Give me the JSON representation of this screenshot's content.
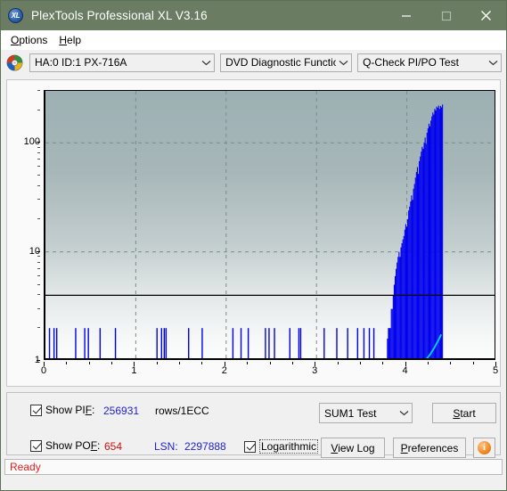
{
  "window": {
    "title": "PlexTools Professional XL V3.16",
    "app_icon": "xl-disc-icon",
    "minimize_label": "–",
    "maximize_label": "□",
    "close_label": "✕",
    "titlebar_color": "#6a7d63"
  },
  "menubar": {
    "items": [
      {
        "label": "Options",
        "accel": "O"
      },
      {
        "label": "Help",
        "accel": "H"
      }
    ]
  },
  "toolbar": {
    "drive_icon": "cd-disc-icon",
    "drive": {
      "value": "HA:0 ID:1  PX-716A"
    },
    "function": {
      "value": "DVD Diagnostic Functions"
    },
    "test": {
      "value": "Q-Check PI/PO Test"
    }
  },
  "chart_data": {
    "type": "bar",
    "title": "",
    "xlabel": "",
    "ylabel": "",
    "logarithmic": true,
    "grid": true,
    "xlim": [
      0,
      5
    ],
    "ylim": [
      1,
      300
    ],
    "xticks": [
      "0",
      "1",
      "2",
      "3",
      "4",
      "5"
    ],
    "yticks": [
      "1",
      "10",
      "100"
    ],
    "threshold_line": 4,
    "legend": [
      "PIF",
      "POF"
    ],
    "series": [
      {
        "name": "PIF",
        "color": "#0000ee",
        "comment": "sparse isolated spikes of height ~2-3 across 0-3.8, then a solid dense block rising from ~3.78 to ~4.40 peaking near 200",
        "spikes_x": [
          0.04,
          0.09,
          0.12,
          0.33,
          0.43,
          0.47,
          0.6,
          0.77,
          1.23,
          1.28,
          1.31,
          1.33,
          1.58,
          1.73,
          2.07,
          2.16,
          2.24,
          2.43,
          2.47,
          2.53,
          2.7,
          2.8,
          2.82,
          3.08,
          3.22,
          3.34,
          3.45,
          3.52,
          3.58,
          3.63
        ],
        "spikes_value": 2,
        "block_start": 3.78,
        "block_end": 4.4,
        "block_profile": [
          1.6,
          2,
          2,
          2,
          3,
          3,
          4,
          5,
          6,
          7,
          8,
          9,
          10,
          9,
          11,
          12,
          13,
          14,
          16,
          18,
          17,
          20,
          24,
          26,
          29,
          33,
          30,
          38,
          42,
          48,
          54,
          60,
          52,
          68,
          75,
          83,
          92,
          88,
          100,
          112,
          98,
          124,
          136,
          150,
          142,
          160,
          175,
          190,
          182,
          205,
          198,
          215,
          210,
          220,
          205,
          218,
          212,
          225
        ]
      },
      {
        "name": "POF",
        "color": "#00ccee",
        "comment": "low cyan trace rising near the end of the block",
        "x": [
          4.18,
          4.22,
          4.26,
          4.3,
          4.34,
          4.38
        ],
        "values": [
          1.0,
          1.05,
          1.15,
          1.3,
          1.5,
          1.75
        ]
      }
    ]
  },
  "controls": {
    "show_pif": {
      "label_pre": "Show PI",
      "label_accel": "F",
      "label_post": ":",
      "checked": true,
      "value": "256931",
      "unit": "rows/1ECC"
    },
    "show_pof": {
      "label_pre": "Show PO",
      "label_accel": "F",
      "label_post": ":",
      "checked": true,
      "value": "654"
    },
    "lsn": {
      "label": "LSN:",
      "value": "2297888"
    },
    "logarithmic": {
      "label": "Logarithmic",
      "checked": true,
      "focused": true
    },
    "test_select": {
      "value": "SUM1 Test"
    },
    "start_button": {
      "label_pre": "",
      "accel": "S",
      "label_post": "tart"
    },
    "view_log_button": {
      "accel": "V",
      "label_post": "iew Log"
    },
    "preferences_button": {
      "accel": "P",
      "label_post": "references"
    },
    "info_button": {
      "label": "i"
    }
  },
  "statusbar": {
    "text": "Ready"
  },
  "colors": {
    "pif_blue": "#0000ee",
    "pof_cyan": "#00ccee",
    "value_blue": "#2222cc",
    "value_red": "#cc1111",
    "status_red": "#e02020",
    "plot_top": "#9cb0b3",
    "plot_bottom": "#fcfdfd"
  }
}
